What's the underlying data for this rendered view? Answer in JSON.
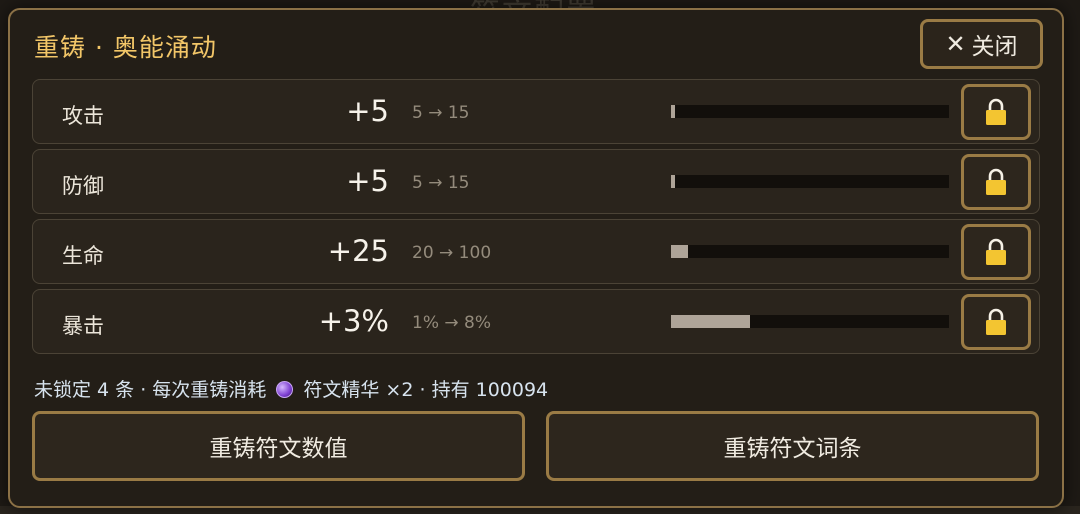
{
  "modal": {
    "title": "重铸 · 奥能涌动",
    "close_label": "关闭",
    "stats": [
      {
        "name": "攻击",
        "value": "+5",
        "range": "5 → 15",
        "fill_fraction": 0.015
      },
      {
        "name": "防御",
        "value": "+5",
        "range": "5 → 15",
        "fill_fraction": 0.015
      },
      {
        "name": "生命",
        "value": "+25",
        "range": "20 → 100",
        "fill_fraction": 0.06
      },
      {
        "name": "暴击",
        "value": "+3%",
        "range": "1% → 8%",
        "fill_fraction": 0.285
      }
    ],
    "info": {
      "prefix": "未锁定 4 条 · 每次重铸消耗",
      "item": "符文精华 ×2",
      "suffix": "· 持有 100094"
    },
    "reroll_values_label": "重铸符文数值",
    "reroll_affixes_label": "重铸符文词条"
  },
  "colors": {
    "accent": "#f2c668",
    "border": "#9a7b45",
    "lock": "#f3c531"
  },
  "icons": [
    "close-icon",
    "lock-icon",
    "essence-orb-icon"
  ]
}
